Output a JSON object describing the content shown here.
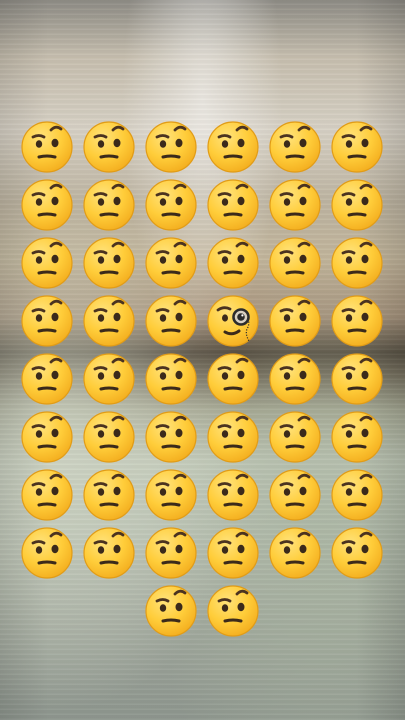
{
  "puzzle": {
    "rows": 8,
    "columns": 6,
    "last_row_count": 2,
    "odd_one": {
      "row": 4,
      "column": 4,
      "kind": "monocle-face"
    },
    "normal_kind": "face-with-raised-eyebrow"
  },
  "colors": {
    "face_fill": "#ffcc3d",
    "face_edge": "#f0a51d",
    "feature": "#3b2a1b",
    "monocle_ring": "#2c2c2c"
  }
}
